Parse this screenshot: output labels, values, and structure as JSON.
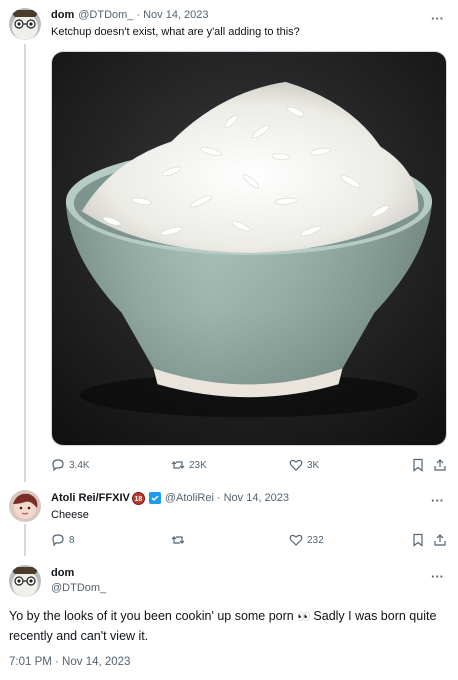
{
  "tweet1": {
    "name": "dom",
    "handle": "@DTDom_",
    "separator": "·",
    "date": "Nov 14, 2023",
    "text": "Ketchup doesn't exist, what are y'all adding to this?",
    "actions": {
      "replies": "3.4K",
      "retweets": "23K",
      "likes": "3K"
    }
  },
  "tweet2": {
    "name": "Atoli Rei/FFXIV",
    "badge": "18",
    "handle": "@AtoliRei",
    "separator": "·",
    "date": "Nov 14, 2023",
    "text": "Cheese",
    "actions": {
      "replies": "8",
      "retweets": "",
      "likes": "232"
    }
  },
  "tweet3": {
    "name": "dom",
    "handle": "@DTDom_",
    "text_part1": "Yo by the looks of it you been cookin' up some porn ",
    "emoji": "👀",
    "text_part2": " Sadly I was born quite recently and can't view it.",
    "timestamp": "7:01 PM · Nov 14, 2023"
  },
  "more_label": "···",
  "colors": {
    "text": "#0f1419",
    "muted": "#536471",
    "accent": "#1d9bf0",
    "line": "#cfd9de"
  }
}
